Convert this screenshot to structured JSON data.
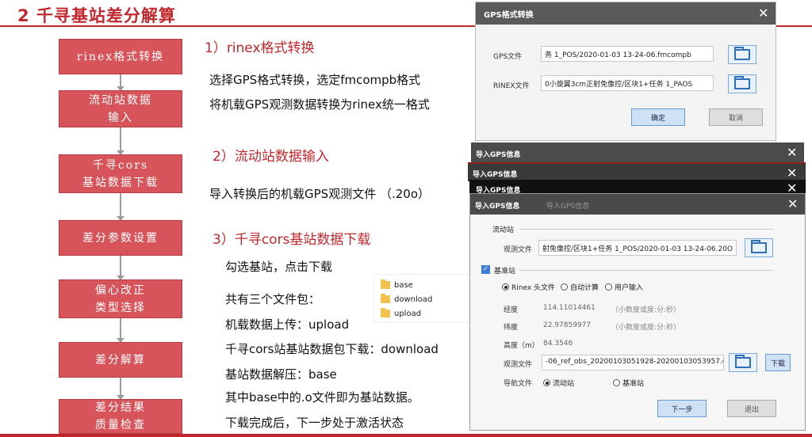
{
  "slide": {
    "title": "2  千寻基站差分解算"
  },
  "flow": {
    "steps": [
      [
        "rinex格式转换"
      ],
      [
        "流动站数据",
        "输入"
      ],
      [
        "千寻cors",
        "基站数据下载"
      ],
      [
        "差分参数设置"
      ],
      [
        "偏心改正",
        "类型选择"
      ],
      [
        "差分解算"
      ],
      [
        "差分结果",
        "质量检查"
      ]
    ]
  },
  "steps_text": {
    "s1_head": "1）rinex格式转换",
    "s1_l1": "选择GPS格式转换，选定fmcompb格式",
    "s1_l2": "将机载GPS观测数据转换为rinex统一格式",
    "s2_head": "2）流动站数据输入",
    "s2_l1": "导入转换后的机载GPS观测文件 （.20o）",
    "s3_head": "3）千寻cors基站数据下载",
    "s3_l1": "勾选基站，点击下载",
    "s3_l2": "共有三个文件包：",
    "s3_l3": "机载数据上传：upload",
    "s3_l4": "千寻cors站基站数据包下载：download",
    "s3_l5": "基站数据解压：base",
    "s3_l6": " 其中base中的.o文件即为基站数据。",
    "s3_l7": "下载完成后，下一步处于激活状态"
  },
  "folders": [
    "base",
    "download",
    "upload"
  ],
  "gps_dialog": {
    "title": "GPS格式转换",
    "close": "✕",
    "gps_label": "GPS文件",
    "gps_value": "务 1_POS/2020-01-03 13-24-06.fmcompb",
    "rinex_label": "RINEX文件",
    "rinex_value": "0小旋翼3cm正射免像控/区块1+任务 1_PAOS",
    "ok": "确定",
    "cancel": "取消"
  },
  "import_stack": {
    "title": "导入GPS信息",
    "close": "✕"
  },
  "import_dialog": {
    "title": "导入GPS信息",
    "ghost_title": "导入GPS信息",
    "close": "✕",
    "rover_group": "流动站",
    "rover_file_label": "观测文件",
    "rover_file_value": "射免像控/区块1+任务 1_POS/2020-01-03 13-24-06.20O",
    "base_group": "基准站",
    "base_check": "✓",
    "opt_rinex": "Rinex 头文件",
    "opt_auto": "自动计算",
    "opt_user": "用户输入",
    "lon_label": "经度",
    "lon_value": "114.11014461",
    "lon_hint": "（小数度或度:分:秒）",
    "lat_label": "纬度",
    "lat_value": "22.97859977",
    "lat_hint": "（小数度或度:分:秒）",
    "h_label": "高度（m）",
    "h_value": "84.3546",
    "base_file_label": "观测文件",
    "base_file_value": "-06_ref_obs_20200103051928-20200103053957.o",
    "download_btn": "下载",
    "nav_label": "导航文件",
    "nav_rover": "流动站",
    "nav_base": "基准站",
    "next_btn": "下一步",
    "exit_btn": "退出"
  },
  "colors": {
    "accent_red": "#c0282e",
    "box_red": "#d6545a",
    "dialog_bar": "#4a4a4a",
    "button_blue": "#cfe1f5"
  },
  "icons": {
    "folder": "folder-icon",
    "close": "close-icon",
    "browse": "folder-open-icon"
  }
}
